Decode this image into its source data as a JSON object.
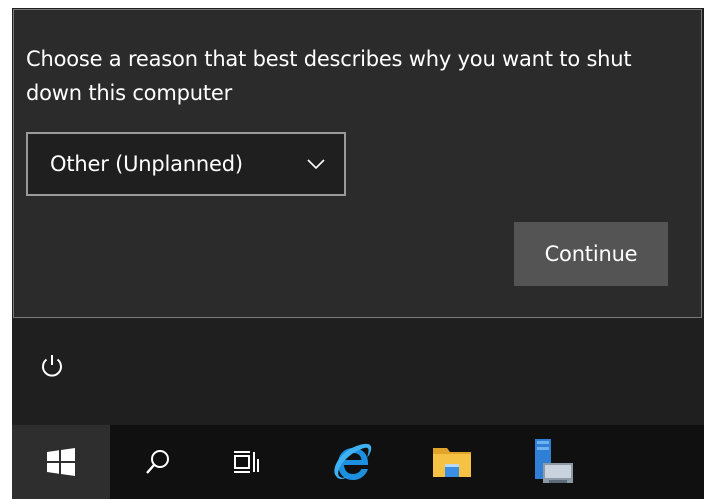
{
  "shutdown_dialog": {
    "prompt": "Choose a reason that best describes why you want to shut down this computer",
    "reason_select": {
      "selected": "Other (Unplanned)",
      "icon": "chevron-down-icon"
    },
    "continue_label": "Continue"
  },
  "start_menu": {
    "power_icon": "power-icon"
  },
  "taskbar": {
    "items": [
      {
        "id": "start",
        "icon": "windows-logo-icon"
      },
      {
        "id": "search",
        "icon": "search-icon"
      },
      {
        "id": "task-view",
        "icon": "task-view-icon"
      },
      {
        "id": "internet-explorer",
        "icon": "internet-explorer-icon"
      },
      {
        "id": "file-explorer",
        "icon": "folder-icon"
      },
      {
        "id": "server-manager",
        "icon": "server-manager-icon"
      }
    ]
  },
  "colors": {
    "panel_bg": "#2b2b2b",
    "menu_bg": "#1f1f1f",
    "taskbar_bg": "#101010",
    "button_bg": "#545454",
    "ie_blue": "#1c8fe0",
    "folder_yellow": "#f6c244"
  }
}
